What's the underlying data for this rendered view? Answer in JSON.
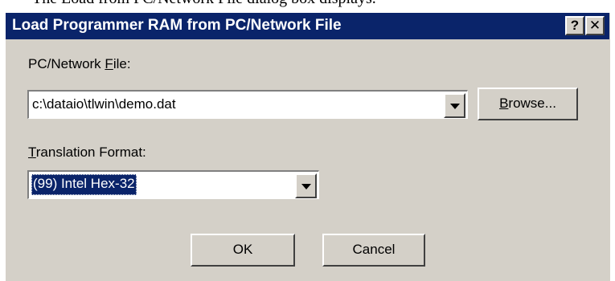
{
  "background_text": "The Load from PC/Network File dialog box displays.",
  "dialog": {
    "title": "Load Programmer RAM from PC/Network File",
    "help_button_label": "?",
    "close_button_label": "✕"
  },
  "file_section": {
    "label_prefix": "PC/Network ",
    "label_accel": "F",
    "label_suffix": "ile:",
    "value": "c:\\dataio\\tlwin\\demo.dat",
    "browse_accel": "B",
    "browse_rest": "rowse..."
  },
  "format_section": {
    "label_accel": "T",
    "label_rest": "ranslation Format:",
    "selected_value": "(99) Intel Hex-32"
  },
  "buttons": {
    "ok_label": "OK",
    "cancel_label": "Cancel"
  }
}
